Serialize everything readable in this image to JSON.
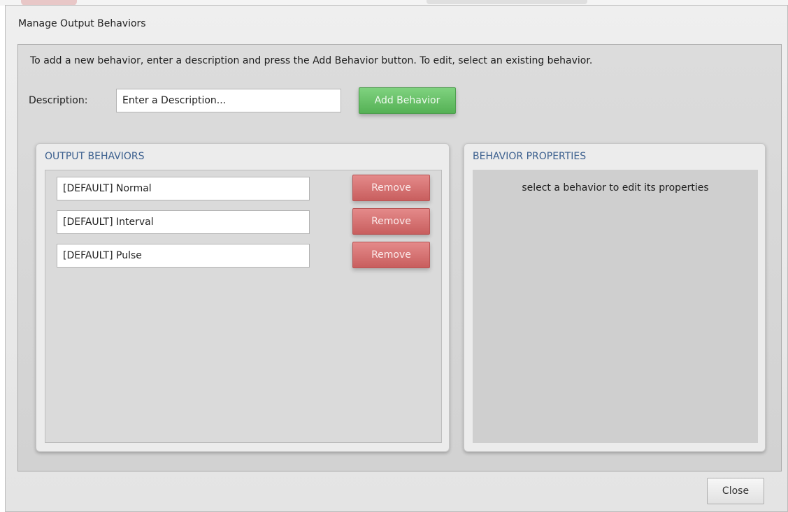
{
  "dialog": {
    "title": "Manage Output Behaviors",
    "instructions": "To add a new behavior, enter a description and press the Add Behavior button. To edit, select an existing behavior.",
    "description_label": "Description:",
    "description_input": {
      "value": "",
      "placeholder": "Enter a Description..."
    },
    "add_button_label": "Add Behavior",
    "close_button_label": "Close"
  },
  "output_behaviors": {
    "title": "OUTPUT BEHAVIORS",
    "remove_label": "Remove",
    "items": [
      {
        "label": "[DEFAULT] Normal"
      },
      {
        "label": "[DEFAULT] Interval"
      },
      {
        "label": "[DEFAULT] Pulse"
      }
    ]
  },
  "behavior_properties": {
    "title": "BEHAVIOR PROPERTIES",
    "hint": "select a behavior to edit its properties"
  },
  "colors": {
    "add_button": "#6cc36c",
    "remove_button": "#d77474",
    "group_title": "#3b5f8e"
  }
}
